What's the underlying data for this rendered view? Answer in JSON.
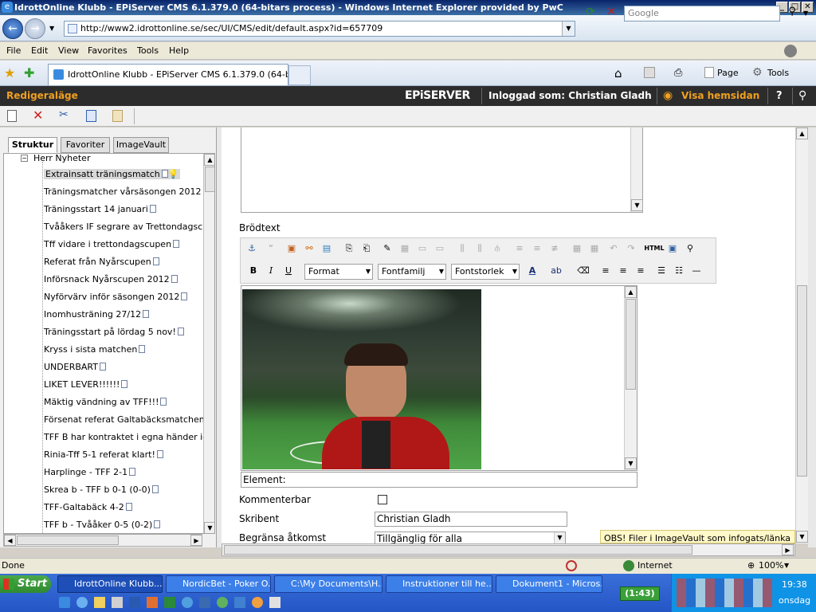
{
  "window": {
    "title": "IdrottOnline Klubb - EPiServer CMS 6.1.379.0 (64-bitars process) - Windows Internet Explorer provided by PwC",
    "min": "_",
    "max": "□",
    "close": "✕"
  },
  "nav": {
    "url": "http://www2.idrottonline.se/sec/UI/CMS/edit/default.aspx?id=657709",
    "search_placeholder": "Google"
  },
  "menu": [
    "File",
    "Edit",
    "View",
    "Favorites",
    "Tools",
    "Help"
  ],
  "browser_tab": {
    "title": "IdrottOnline Klubb - EPiServer CMS 6.1.379.0 (64-bita...",
    "page_label": "Page",
    "tools_label": "Tools"
  },
  "epi": {
    "mode": "Redigeraläge",
    "logo": "EPiSERVER",
    "logged_in": "Inloggad som: Christian Gladh",
    "view_site": "Visa hemsidan",
    "help": "?"
  },
  "panel": {
    "tabs": [
      "Struktur",
      "Favoriter",
      "ImageVault"
    ],
    "parent": "Herr Nyheter",
    "items": [
      "Extrainsatt träningsmatch",
      "Träningsmatcher vårsäsongen 2012",
      "Träningsstart 14 januari",
      "Tvååkers IF segrare av Trettondagscu",
      "Tff vidare i trettondagscupen",
      "Referat från Nyårscupen",
      "Införsnack Nyårscupen 2012",
      "Nyförvärv inför säsongen 2012",
      "Inomhusträning 27/12",
      "Träningsstart på lördag 5 nov!",
      "Kryss i sista matchen",
      "UNDERBART",
      "LIKET LEVER!!!!!!",
      "Mäktig vändning av TFF!!!",
      "Försenat referat Galtabäcksmatchen",
      "TFF B har kontraktet i egna händer ige",
      "Rinia-Tff 5-1 referat klart!",
      "Harplinge - TFF 2-1",
      "Skrea b - TFF b 0-1 (0-0)",
      "TFF-Galtabäck 4-2",
      "TFF b - Tvååker 0-5 (0-2)"
    ]
  },
  "editor": {
    "brodtext_label": "Brödtext",
    "format": "Format",
    "fontfamily": "Fontfamilj",
    "fontsize": "Fontstorlek",
    "html_btn": "HTML",
    "element_label": "Element:",
    "kommenterbar_label": "Kommenterbar",
    "skribent_label": "Skribent",
    "skribent_value": "Christian Gladh",
    "access_label": "Begränsa åtkomst",
    "access_value": "Tillgänglig för alla",
    "note": "OBS! Filer i ImageVault som infogats/länka"
  },
  "status": {
    "text": "Done",
    "zone": "Internet",
    "zoom": "100%"
  },
  "taskbar": {
    "start": "Start",
    "tasks": [
      "IdrottOnline Klubb...",
      "NordicBet - Poker O...",
      "C:\\My Documents\\H...",
      "Instruktioner till he...",
      "Dokument1 - Micros..."
    ],
    "timer": "(1:43)",
    "clock": "19:38",
    "day": "onsdag"
  }
}
